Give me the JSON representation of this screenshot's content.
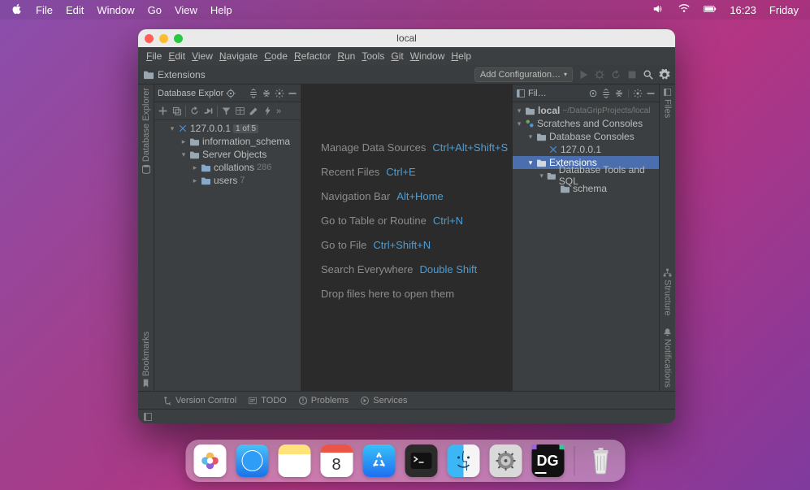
{
  "mac_menu": {
    "items": [
      "File",
      "Edit",
      "Window",
      "Go",
      "View",
      "Help"
    ],
    "time": "16:23",
    "day": "Friday"
  },
  "window": {
    "title": "local"
  },
  "ide_menu": [
    "File",
    "Edit",
    "View",
    "Navigate",
    "Code",
    "Refactor",
    "Run",
    "Tools",
    "Git",
    "Window",
    "Help"
  ],
  "navbar": {
    "breadcrumb": "Extensions",
    "run_config": "Add Configuration…"
  },
  "db_explorer": {
    "title": "Database Explor",
    "root": {
      "label": "127.0.0.1",
      "badge": "1 of 5"
    },
    "children": [
      {
        "label": "information_schema"
      },
      {
        "label": "Server Objects",
        "children": [
          {
            "label": "collations",
            "count": "286"
          },
          {
            "label": "users",
            "count": "7"
          }
        ]
      }
    ]
  },
  "editor_hints": [
    {
      "label": "Manage Data Sources",
      "shortcut": "Ctrl+Alt+Shift+S"
    },
    {
      "label": "Recent Files",
      "shortcut": "Ctrl+E"
    },
    {
      "label": "Navigation Bar",
      "shortcut": "Alt+Home"
    },
    {
      "label": "Go to Table or Routine",
      "shortcut": "Ctrl+N"
    },
    {
      "label": "Go to File",
      "shortcut": "Ctrl+Shift+N"
    },
    {
      "label": "Search Everywhere",
      "shortcut": "Double Shift"
    },
    {
      "label": "Drop files here to open them",
      "shortcut": ""
    }
  ],
  "files_panel": {
    "title": "Fil…",
    "root": {
      "label": "local",
      "path": "~/DataGripProjects/local"
    },
    "scratches": {
      "label": "Scratches and Consoles",
      "consoles": {
        "label": "Database Consoles",
        "host": "127.0.0.1"
      },
      "extensions": {
        "label": "Extensions",
        "dbtools": {
          "label": "Database Tools and SQL",
          "schema": "schema"
        }
      }
    }
  },
  "gutters": {
    "left_top": "Database Explorer",
    "left_bottom": "Bookmarks",
    "right_top": "Files",
    "right_mid": "Structure",
    "right_bottom": "Notifications"
  },
  "statusbar": {
    "vcs": "Version Control",
    "todo": "TODO",
    "problems": "Problems",
    "services": "Services"
  },
  "dock": {
    "calendar_day": "8",
    "datagrip": "DG"
  }
}
